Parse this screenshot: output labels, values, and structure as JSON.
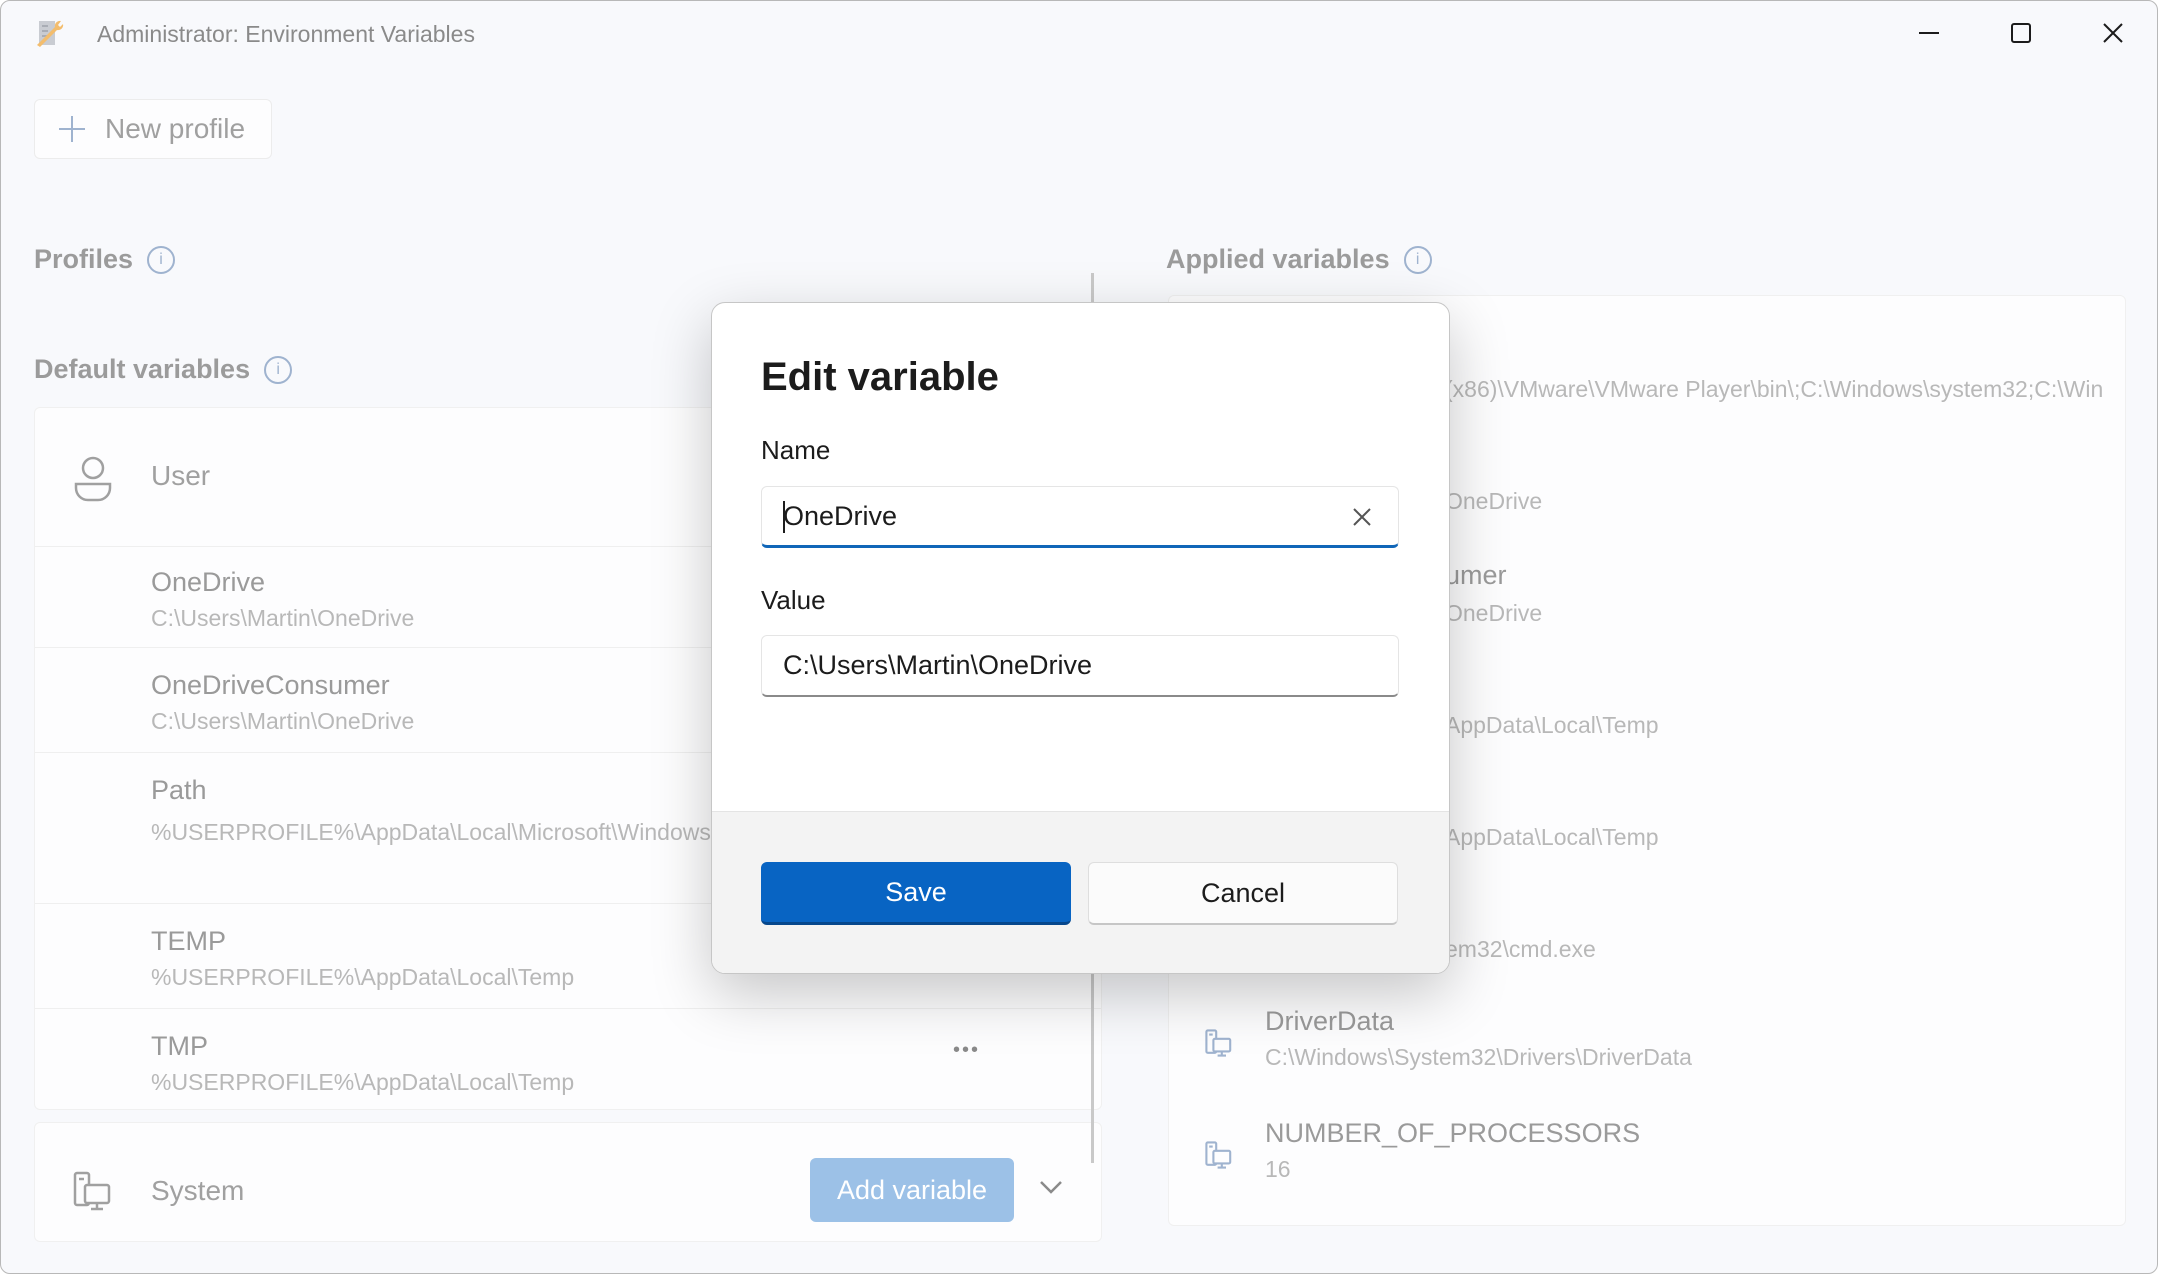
{
  "window": {
    "title": "Administrator: Environment Variables",
    "controls": {
      "minimize": "minimize-icon",
      "maximize": "maximize-icon",
      "close": "close-icon"
    }
  },
  "toolbar": {
    "new_profile_label": "New profile",
    "new_profile_icon": "plus-icon"
  },
  "profiles": {
    "heading": "Profiles",
    "info_glyph": "i"
  },
  "default_variables": {
    "heading": "Default variables",
    "info_glyph": "i",
    "user": {
      "label": "User",
      "icon": "user-icon",
      "items": [
        {
          "name": "OneDrive",
          "value": "C:\\Users\\Martin\\OneDrive"
        },
        {
          "name": "OneDriveConsumer",
          "value": "C:\\Users\\Martin\\OneDrive"
        },
        {
          "name": "Path",
          "value": "%USERPROFILE%\\AppData\\Local\\Microsoft\\Windows"
        },
        {
          "name": "TEMP",
          "value": "%USERPROFILE%\\AppData\\Local\\Temp"
        },
        {
          "name": "TMP",
          "value": "%USERPROFILE%\\AppData\\Local\\Temp",
          "more_glyph": "•••"
        }
      ]
    },
    "system": {
      "label": "System",
      "icon": "system-icon",
      "add_variable_label": "Add variable"
    }
  },
  "applied_variables": {
    "heading": "Applied variables",
    "info_glyph": "i",
    "items": [
      {
        "name": "",
        "value": "(x86)\\VMware\\VMware Player\\bin\\;C:\\Windows\\system32;C:\\Win"
      },
      {
        "name": "",
        "value": "OneDrive"
      },
      {
        "name": "umer",
        "value": "OneDrive"
      },
      {
        "name": "",
        "value": "AppData\\Local\\Temp"
      },
      {
        "name": "",
        "value": "AppData\\Local\\Temp"
      },
      {
        "name": "",
        "value": "em32\\cmd.exe"
      },
      {
        "name": "DriverData",
        "value": "C:\\Windows\\System32\\Drivers\\DriverData"
      },
      {
        "name": "NUMBER_OF_PROCESSORS",
        "value": "16"
      }
    ]
  },
  "dialog": {
    "title": "Edit variable",
    "name_label": "Name",
    "name_value": "OneDrive",
    "value_label": "Value",
    "value_value": "C:\\Users\\Martin\\OneDrive",
    "save_label": "Save",
    "cancel_label": "Cancel"
  },
  "colors": {
    "accent": "#0864c3",
    "accent_disabled": "#9cc1e7",
    "info": "#9fb3cf"
  }
}
